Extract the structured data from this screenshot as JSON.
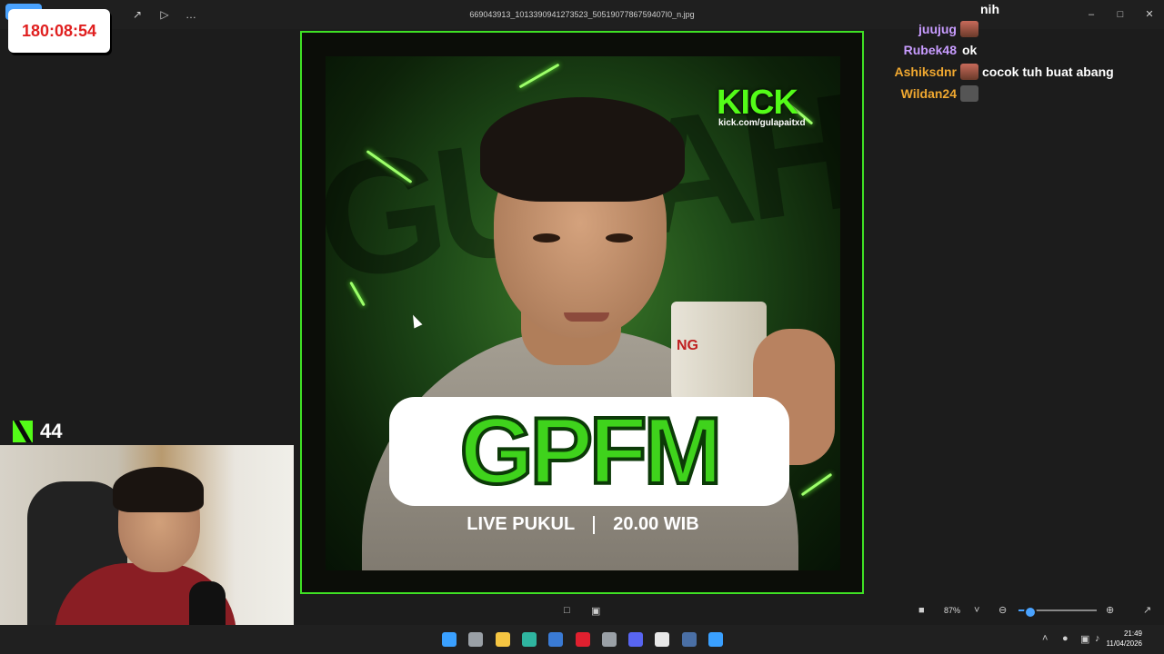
{
  "window": {
    "file_name": "669043913_1013390941273523_5051907786759407I0_n.jpg",
    "controls": {
      "minimize": "–",
      "maximize": "□",
      "close": "✕"
    },
    "more_label": "…"
  },
  "timer": {
    "value": "180:08:54"
  },
  "poster": {
    "bg_text": "GULAH",
    "brand": "KICK",
    "url": "kick.com/gulapaitxd",
    "title": "GPFM",
    "live_label": "LIVE PUKUL",
    "time_label": "20.00 WIB",
    "mug_text": "NG",
    "accent": "#53fc18"
  },
  "chat": {
    "top_fragment": "nih",
    "messages": [
      {
        "user": "juujug",
        "color": "#c89cff",
        "msg": ""
      },
      {
        "user": "Rubek48",
        "color": "#c89cff",
        "msg": "ok"
      },
      {
        "user": "Ashiksdnr",
        "color": "#f0a830",
        "msg": "cocok tuh buat abang"
      },
      {
        "user": "Wildan24",
        "color": "#f0a830",
        "msg": ""
      }
    ]
  },
  "viewers": {
    "count": "44"
  },
  "viewer_controls": {
    "zoom": "87%",
    "zoom_level": 0.15
  },
  "taskbar": {
    "time": "21:49",
    "date": "11/04/2026",
    "apps": [
      {
        "name": "start-icon",
        "color": "#3aa0ff"
      },
      {
        "name": "task-view-icon",
        "color": "#9aa0a6"
      },
      {
        "name": "file-explorer-icon",
        "color": "#f5c542"
      },
      {
        "name": "edge-icon",
        "color": "#2fb5a0"
      },
      {
        "name": "store-icon",
        "color": "#3a7bd5"
      },
      {
        "name": "opera-icon",
        "color": "#e0202f"
      },
      {
        "name": "chrome-icon",
        "color": "#9aa0a6"
      },
      {
        "name": "discord-icon",
        "color": "#5865f2"
      },
      {
        "name": "capcut-icon",
        "color": "#e8e8e8"
      },
      {
        "name": "steam-icon",
        "color": "#4a6fa5"
      },
      {
        "name": "photos-icon",
        "color": "#3aa0ff"
      }
    ]
  }
}
